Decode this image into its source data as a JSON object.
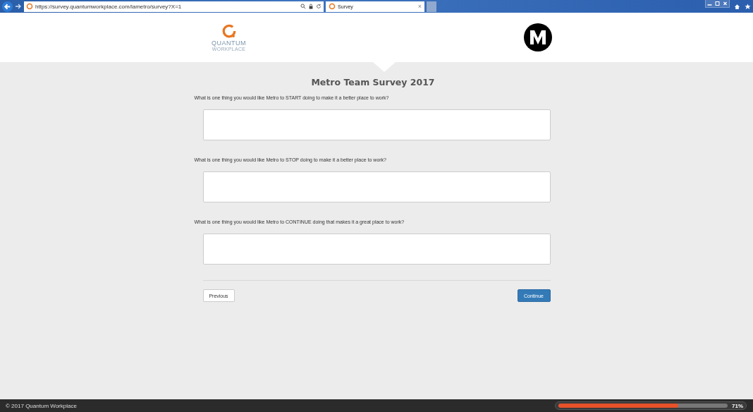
{
  "browser": {
    "url": "https://survey.quantumworkplace.com/lametro/survey?X=1",
    "tab": {
      "title": "Survey",
      "close": "×"
    }
  },
  "header": {
    "logo_line1": "QUANTUM",
    "logo_line2": "WORKPLACE"
  },
  "survey": {
    "title": "Metro Team Survey 2017",
    "questions": [
      {
        "text": "What is one thing you would like Metro to START doing to make it a better place to work?"
      },
      {
        "text": "What is one thing you would like Metro to STOP doing to make it a better place to work?"
      },
      {
        "text": "What is one thing you would like Metro to CONTINUE doing that makes it a great place to work?"
      }
    ],
    "buttons": {
      "previous": "Previous",
      "continue": "Continue"
    }
  },
  "footer": {
    "copyright": "© 2017 Quantum Workplace",
    "progress": {
      "level": 0.71,
      "reading": "71%"
    }
  }
}
